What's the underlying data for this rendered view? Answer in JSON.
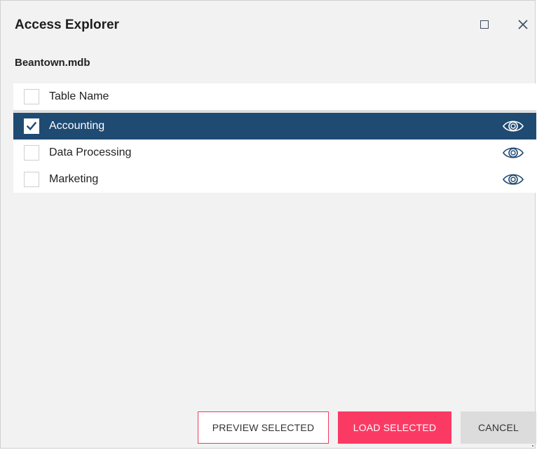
{
  "dialog": {
    "title": "Access Explorer",
    "filename": "Beantown.mdb",
    "maximize_icon": "maximize-icon",
    "close_icon": "close-icon"
  },
  "table": {
    "header": {
      "label": "Table Name",
      "checked": false
    },
    "rows": [
      {
        "label": "Accounting",
        "checked": true,
        "selected": true,
        "icon": "eye-icon"
      },
      {
        "label": "Data Processing",
        "checked": false,
        "selected": false,
        "icon": "eye-icon"
      },
      {
        "label": "Marketing",
        "checked": false,
        "selected": false,
        "icon": "eye-icon"
      }
    ]
  },
  "buttons": {
    "preview_label": "PREVIEW SELECTED",
    "load_label": "LOAD SELECTED",
    "cancel_label": "CANCEL"
  },
  "colors": {
    "selected_row": "#1f4a72",
    "accent_pink": "#fb3a64",
    "eye_blue": "#1f4a72"
  }
}
